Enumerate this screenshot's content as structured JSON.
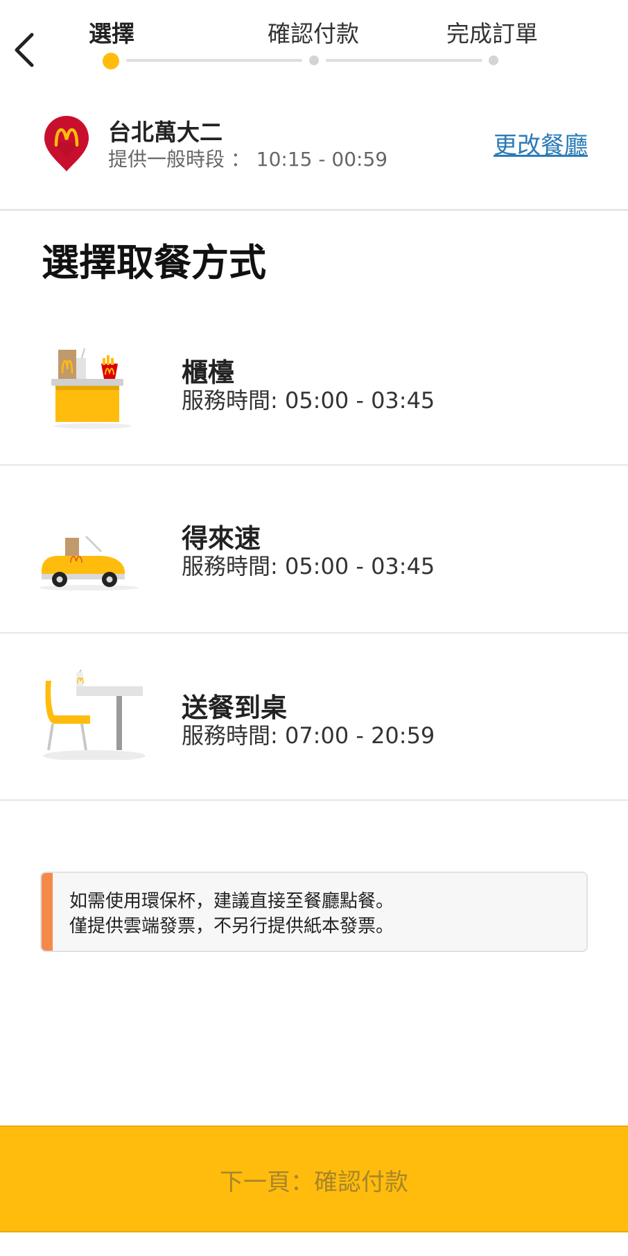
{
  "stepper": {
    "steps": [
      {
        "label": "選擇",
        "active": true
      },
      {
        "label": "確認付款",
        "active": false
      },
      {
        "label": "完成訂單",
        "active": false
      }
    ],
    "back_icon": "chevron-left-icon"
  },
  "restaurant": {
    "logo_icon": "mcdonalds-location-pin-icon",
    "name": "台北萬大二",
    "hours": "提供一般時段 ： 10:15 - 00:59",
    "change_label": "更改餐廳"
  },
  "pickup": {
    "title": "選擇取餐方式",
    "options": [
      {
        "name": "櫃檯",
        "time": "服務時間: 05:00 - 03:45",
        "icon": "counter-icon"
      },
      {
        "name": "得來速",
        "time": "服務時間: 05:00 - 03:45",
        "icon": "drive-thru-car-icon"
      },
      {
        "name": "送餐到桌",
        "time": "服務時間: 07:00 - 20:59",
        "icon": "table-service-icon"
      }
    ]
  },
  "notice": {
    "lines": [
      "如需使用環保杯，建議直接至餐廳點餐。",
      "僅提供雲端發票，不另行提供紙本發票。"
    ]
  },
  "footer": {
    "next_label": "下一頁：確認付款"
  },
  "colors": {
    "accent_yellow": "#ffbc0d",
    "brand_red": "#c8102e",
    "link_blue": "#2a7bb8",
    "notice_orange": "#f4894a"
  }
}
